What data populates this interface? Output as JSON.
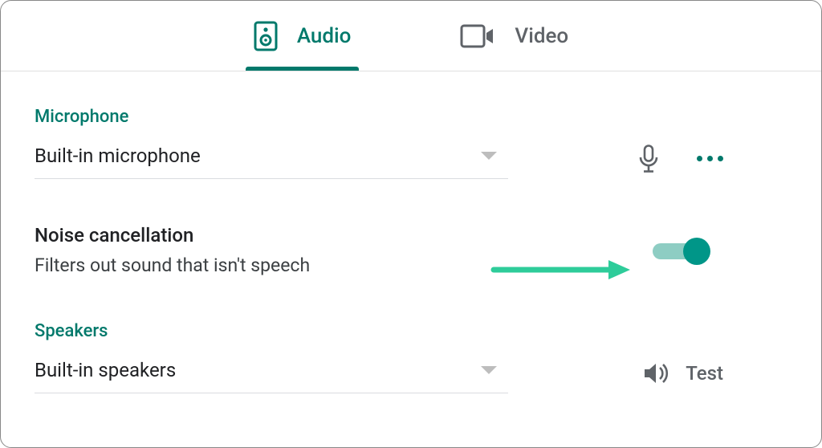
{
  "tabs": {
    "audio": "Audio",
    "video": "Video"
  },
  "microphone": {
    "section": "Microphone",
    "selected": "Built-in microphone"
  },
  "noise": {
    "title": "Noise cancellation",
    "desc": "Filters out sound that isn't speech",
    "enabled": true
  },
  "speakers": {
    "section": "Speakers",
    "selected": "Built-in speakers",
    "test": "Test"
  },
  "colors": {
    "accent": "#00796b",
    "toggle_thumb": "#009688",
    "toggle_track": "#8ecdc3",
    "arrow": "#2ecc9a"
  }
}
